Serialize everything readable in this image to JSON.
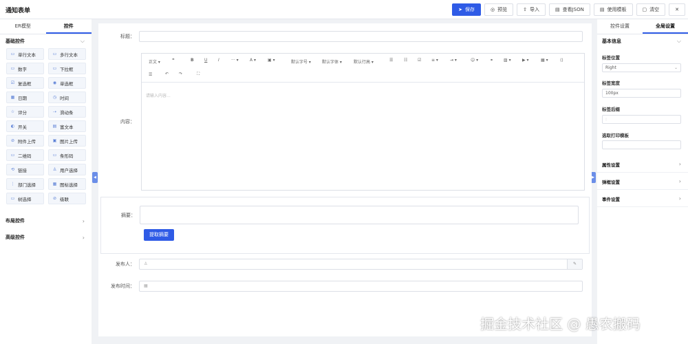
{
  "app_title": "通知表单",
  "toolbar": {
    "save": "保存",
    "preview": "预览",
    "import": "导入",
    "view_json": "查看JSON",
    "use_template": "使用模板",
    "clear": "清空",
    "close": "✕"
  },
  "left": {
    "tabs": [
      "ER模型",
      "控件"
    ],
    "basic_title": "基础控件",
    "widgets": [
      "单行文本",
      "多行文本",
      "数字",
      "下拉框",
      "复选框",
      "单选框",
      "日期",
      "时间",
      "评分",
      "滑动条",
      "开关",
      "富文本",
      "附件上传",
      "图片上传",
      "二维码",
      "条形码",
      "链接",
      "用户选择",
      "部门选择",
      "图标选择",
      "树选择",
      "级联"
    ],
    "layout_title": "布局控件",
    "advanced_title": "高级控件"
  },
  "form": {
    "title_label": "标题：",
    "content_label": "内容：",
    "editor_tools": [
      "正文",
      "默认字号",
      "默认字体",
      "默认行高"
    ],
    "editor_placeholder": "请输入内容...",
    "summary_label": "摘要：",
    "summary_button": "提取摘要",
    "publisher_label": "发布人：",
    "publish_time_label": "发布时间："
  },
  "right": {
    "tabs": [
      "控件设置",
      "全局设置"
    ],
    "basic_title": "基本信息",
    "label_position": "标签位置",
    "label_position_value": "Right",
    "label_width": "标签宽度",
    "label_width_value": "100px",
    "label_suffix": "标签后缀",
    "label_suffix_value": ":",
    "print_template": "选取打印模板",
    "props": "属性设置",
    "popup": "弹框设置",
    "events": "事件设置"
  },
  "watermark": "掘金技术社区 @ 愚农搬码",
  "colors": {
    "primary": "#2f5be6"
  }
}
